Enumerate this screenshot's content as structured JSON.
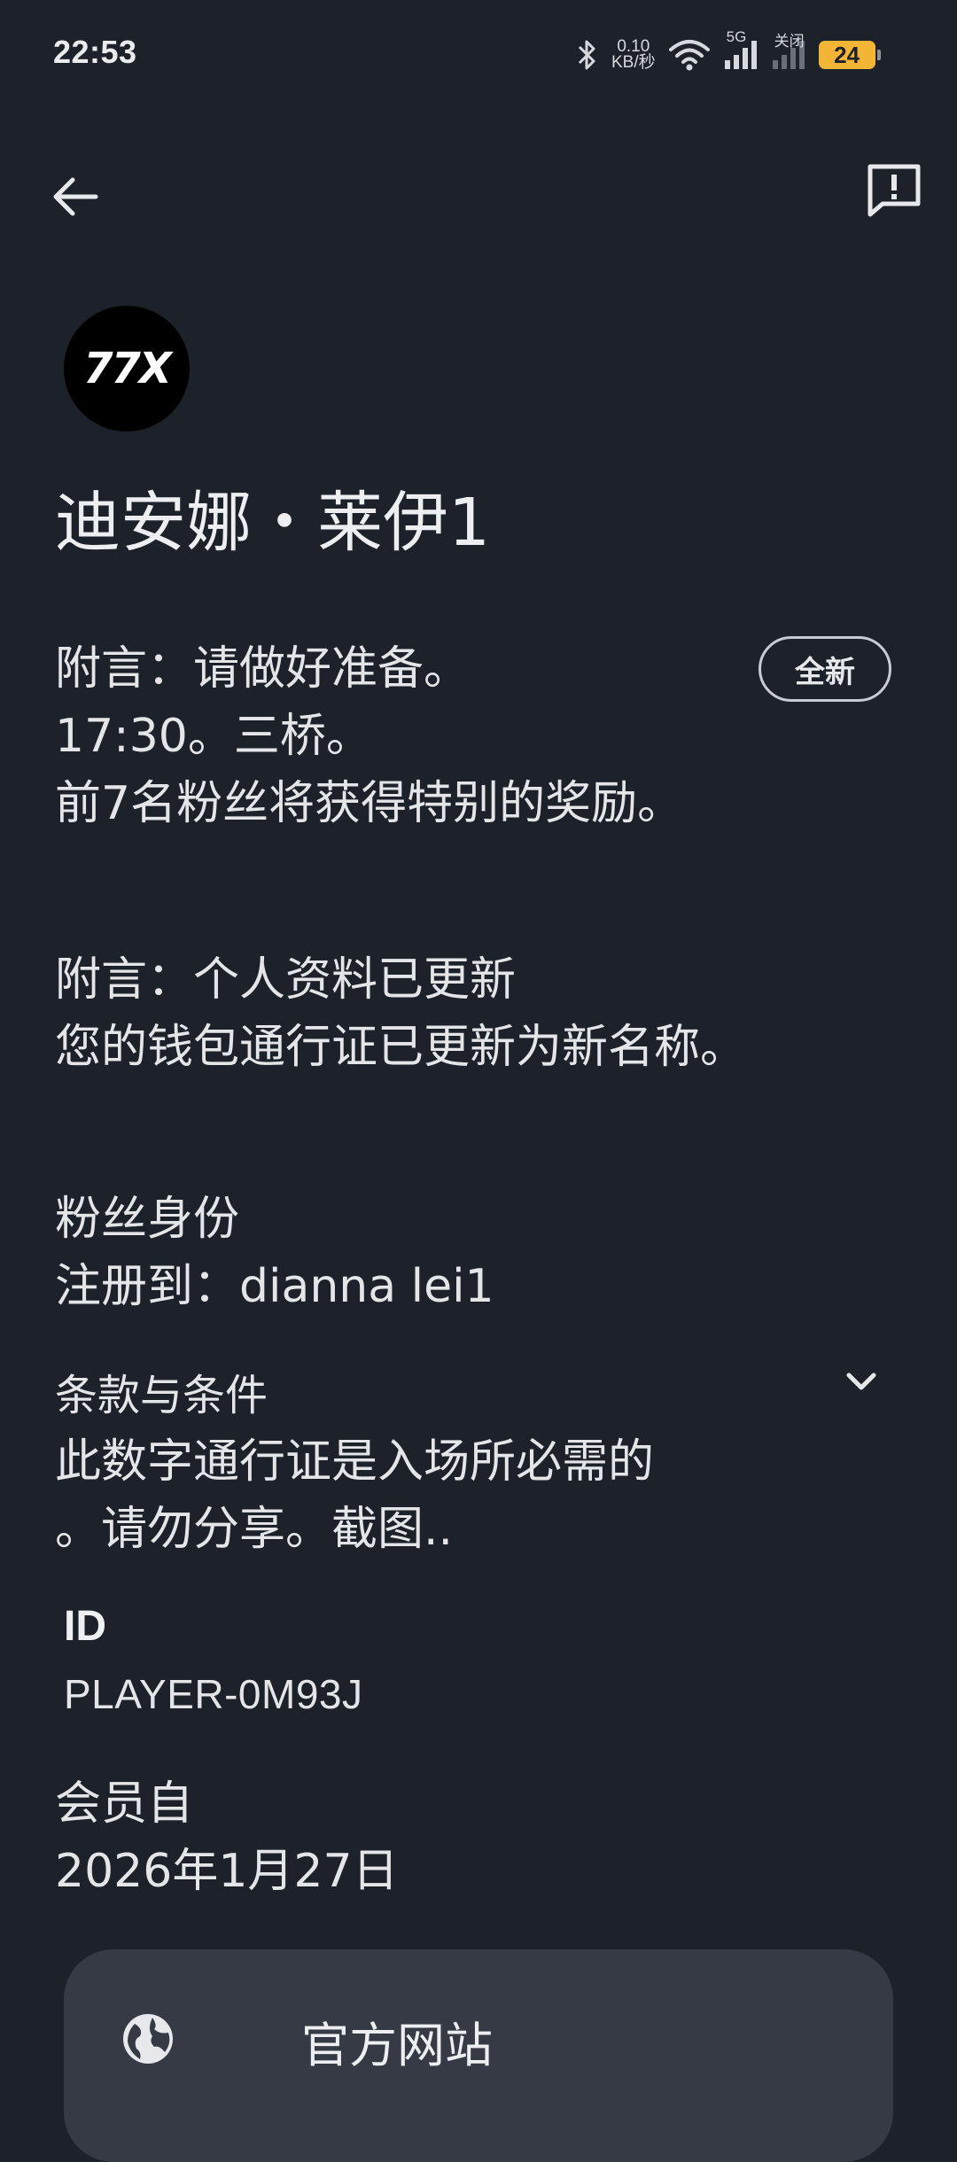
{
  "status_bar": {
    "time": "22:53",
    "net_speed_value": "0.10",
    "net_speed_unit": "KB/秒",
    "sim_label": "5G",
    "sim2_label": "关闭",
    "battery": "24"
  },
  "pass": {
    "logo_text": "77X",
    "holder_name": "迪安娜・莱伊1",
    "badge": "全新",
    "note1_lines": [
      "附言：请做好准备。",
      "17:30。三桥。",
      "前7名粉丝将获得特别的奖励。"
    ],
    "note2_lines": [
      "附言：个人资料已更新",
      "您的钱包通行证已更新为新名称。"
    ],
    "fan_identity_lines": [
      "粉丝身份",
      "注册到：dianna lei1"
    ],
    "terms_title": "条款与条件",
    "terms_lines": [
      "此数字通行证是入场所必需的",
      "。请勿分享。截图.."
    ],
    "id_label": "ID",
    "id_value": "PLAYER-0M93J",
    "member_since_label": "会员自",
    "member_since_value": "2026年1月27日",
    "website_button": "官方网站"
  },
  "colors": {
    "background": "#1d2129",
    "button_surface": "#353a44",
    "battery": "#f2b536"
  },
  "icons": {
    "back": "arrow-left-icon",
    "feedback": "feedback-icon",
    "expand": "chevron-down-icon",
    "website": "globe-icon"
  }
}
